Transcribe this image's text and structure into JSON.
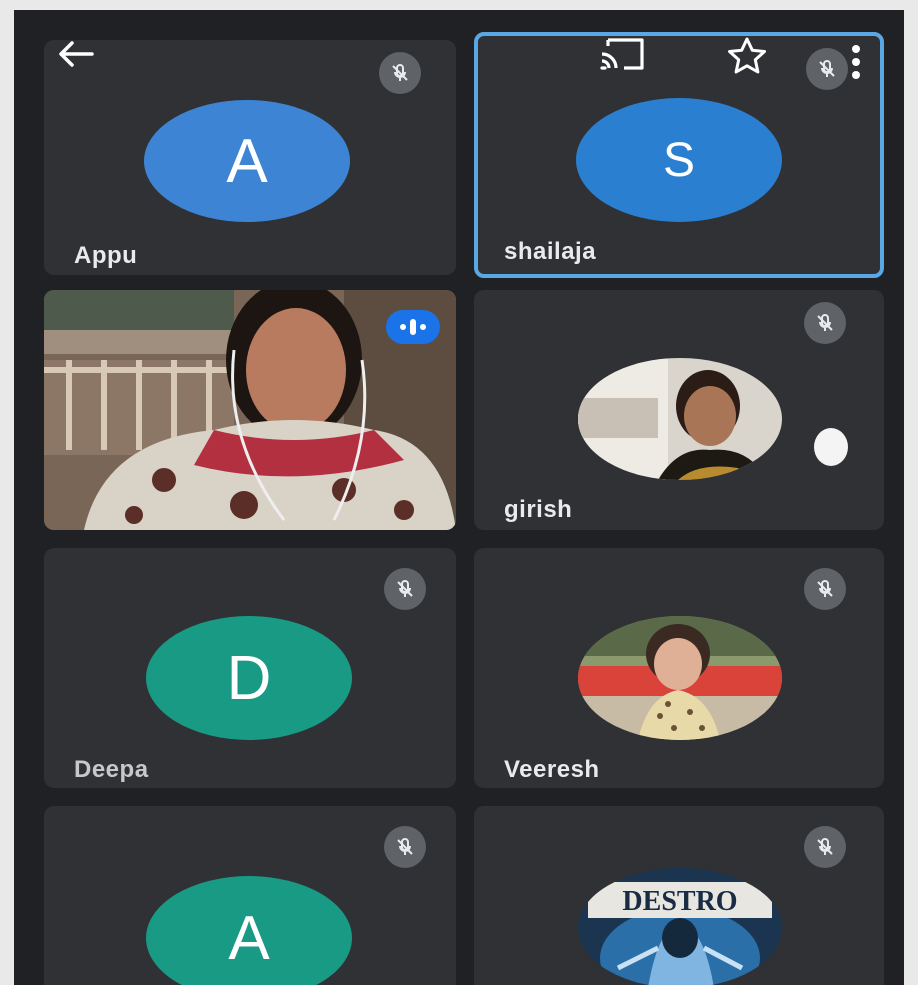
{
  "meeting": {
    "participants": [
      {
        "name": "Appu",
        "initial": "A",
        "color": "#3d84d4",
        "muted": true
      },
      {
        "name": "shailaja",
        "initial": "S",
        "color": "#2a7fd0",
        "muted": true,
        "pinned": true
      },
      {
        "name": "",
        "video": true,
        "speaking": true
      },
      {
        "name": "girish",
        "photo": "profile-photo",
        "muted": true
      },
      {
        "name": "Deepa",
        "initial": "D",
        "color": "#199a85",
        "muted": true
      },
      {
        "name": "Veeresh",
        "photo": "profile-photo",
        "muted": true
      },
      {
        "name": "",
        "initial": "A",
        "color": "#199a85",
        "muted": true
      },
      {
        "name": "",
        "photo": "logo-photo",
        "photo_text": "DESTRO",
        "muted": true
      }
    ]
  },
  "icons": {
    "back": "arrow-left-icon",
    "cast": "cast-icon",
    "star": "star-outline-icon",
    "more": "more-vert-icon",
    "muted": "mic-off-icon",
    "speaking": "audio-level-icon"
  }
}
